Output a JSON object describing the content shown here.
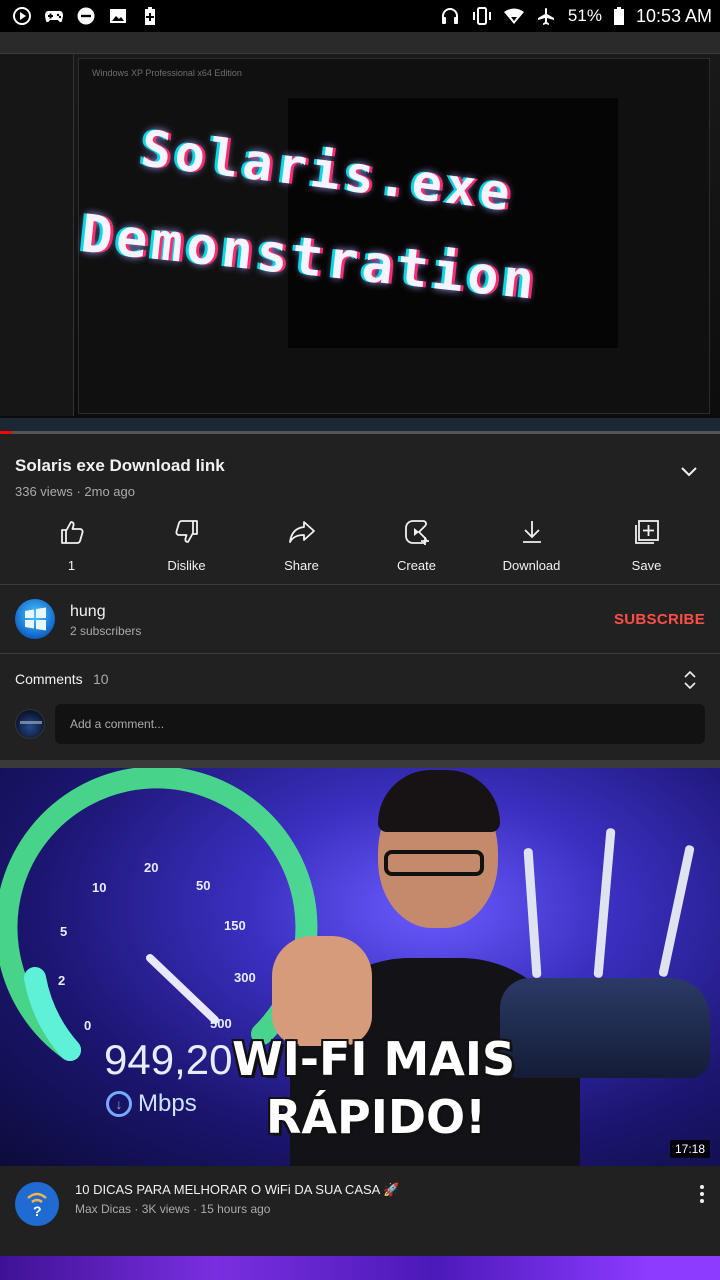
{
  "status_bar": {
    "battery_percent": "51%",
    "time": "10:53 AM",
    "icons_left": [
      "media-play-icon",
      "game-controller-icon",
      "do-not-disturb-icon",
      "image-icon",
      "battery-saver-icon"
    ],
    "icons_right": [
      "headset-icon",
      "vibrate-icon",
      "wifi-icon",
      "airplane-mode-icon",
      "battery-icon"
    ]
  },
  "player": {
    "window_title": "Windows XP Professional x64 Edition",
    "overlay_line1": "Solaris.exe",
    "overlay_line2": "Demonstration",
    "progress_fraction": 0.017
  },
  "video": {
    "title": "Solaris exe Download link",
    "views": "336 views",
    "age": "2mo ago"
  },
  "actions": [
    {
      "key": "like",
      "label": "1",
      "icon": "thumbs-up-icon"
    },
    {
      "key": "dislike",
      "label": "Dislike",
      "icon": "thumbs-down-icon"
    },
    {
      "key": "share",
      "label": "Share",
      "icon": "share-icon"
    },
    {
      "key": "create",
      "label": "Create",
      "icon": "create-icon"
    },
    {
      "key": "download",
      "label": "Download",
      "icon": "download-icon"
    },
    {
      "key": "save",
      "label": "Save",
      "icon": "save-playlist-icon"
    }
  ],
  "channel": {
    "name": "hung",
    "subscribers": "2 subscribers",
    "subscribe_label": "SUBSCRIBE",
    "subscribe_color": "#ff4e45"
  },
  "comments": {
    "label": "Comments",
    "count": "10",
    "placeholder": "Add a comment..."
  },
  "recommended": {
    "thumbnail_speed": "949,20",
    "thumbnail_unit": "Mbps",
    "thumbnail_line1": "WI-FI MAIS",
    "thumbnail_line2": "RÁPIDO!",
    "gauge_ticks": [
      "0",
      "2",
      "5",
      "10",
      "20",
      "50",
      "150",
      "300",
      "500"
    ],
    "duration": "17:18",
    "title": "10 DICAS PARA MELHORAR O WiFi DA SUA CASA 🚀",
    "channel": "Max Dicas",
    "views": "3K views",
    "age": "15 hours ago"
  },
  "colors": {
    "background": "#212121",
    "accent_red": "#ff0000",
    "text_primary": "#f1f1f1",
    "text_secondary": "#aaaaaa"
  }
}
